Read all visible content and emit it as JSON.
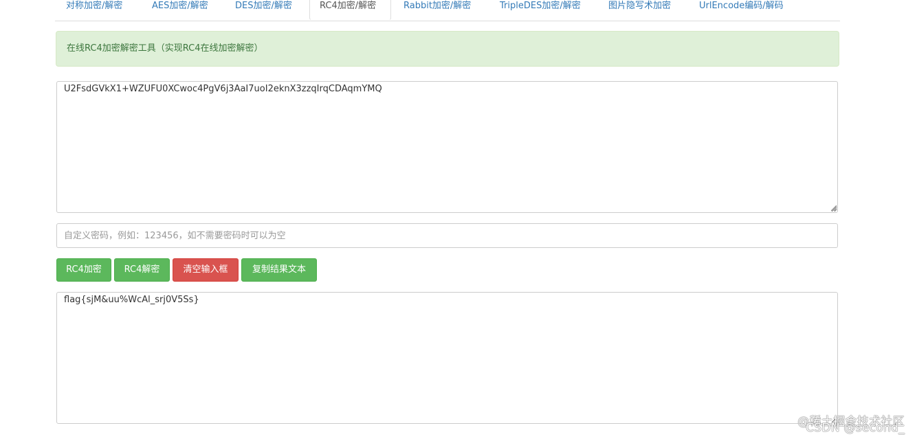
{
  "tabs": [
    {
      "label": "对称加密/解密"
    },
    {
      "label": "AES加密/解密"
    },
    {
      "label": "DES加密/解密"
    },
    {
      "label": "RC4加密/解密",
      "active": true
    },
    {
      "label": "Rabbit加密/解密"
    },
    {
      "label": "TripleDES加密/解密"
    },
    {
      "label": "图片隐写术加密"
    },
    {
      "label": "UrlEncode编码/解码"
    }
  ],
  "alert": {
    "text": "在线RC4加密解密工具（实现RC4在线加密解密）"
  },
  "input": {
    "value": "U2FsdGVkX1+WZUFU0XCwoc4PgV6j3AaI7uoI2eknX3zzqIrqCDAqmYMQ"
  },
  "password": {
    "placeholder": "自定义密码，例如：123456，如不需要密码时可以为空",
    "value": ""
  },
  "buttons": {
    "encrypt": "RC4加密",
    "decrypt": "RC4解密",
    "clear": "清空输入框",
    "copy": "复制结果文本"
  },
  "output": {
    "value": "flag{sjM&uu%WcAl_srj0V5Ss}"
  },
  "watermark": {
    "line1": "@稀土掘金技术社区",
    "line2": "CSDN @second_"
  },
  "colors": {
    "tab_link": "#337ab7",
    "alert_bg": "#dff0d8",
    "alert_text": "#3c763d",
    "success": "#5cb85c",
    "danger": "#d9534f"
  }
}
